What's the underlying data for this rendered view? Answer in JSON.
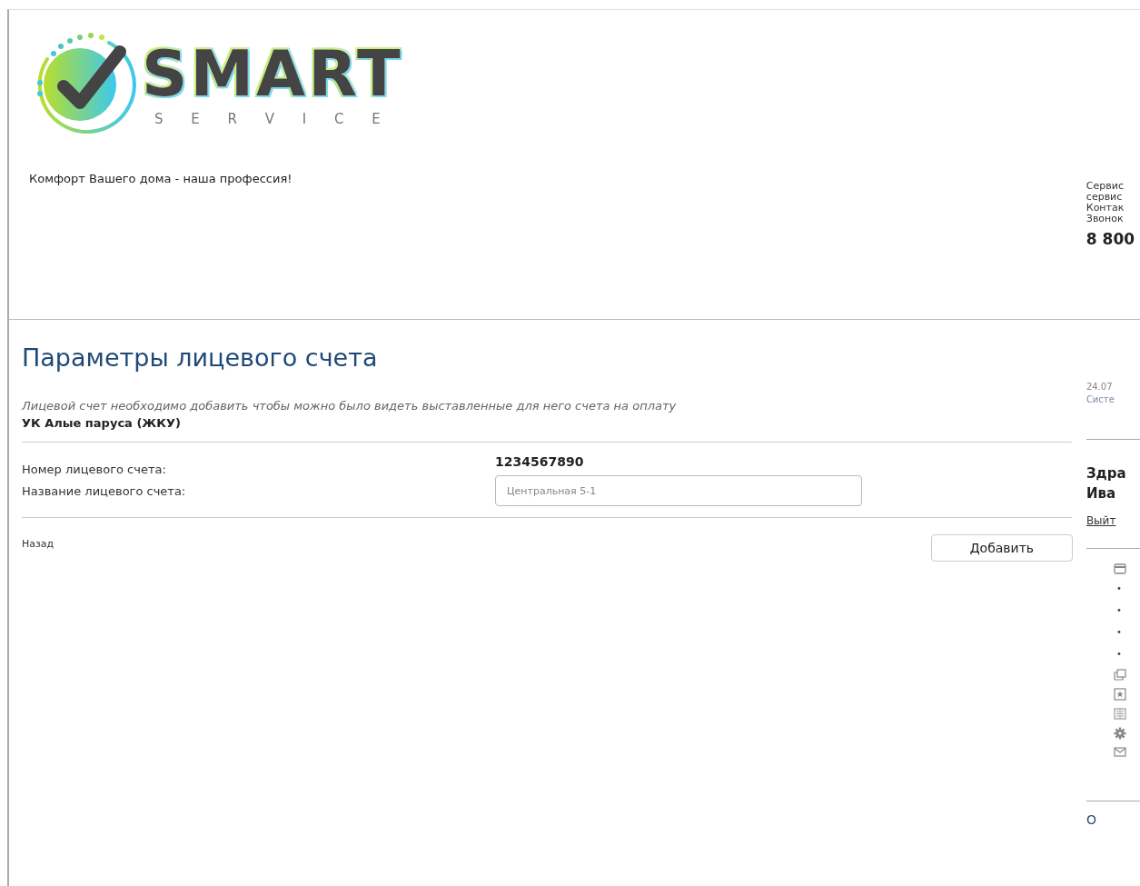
{
  "header": {
    "logo": {
      "word": "SMART",
      "subword": "S E R V I C E"
    },
    "tagline": "Комфорт Вашего дома - наша профессия!",
    "contact_lines": [
      "Сервис",
      "сервис",
      "Контак",
      "Звонок"
    ],
    "phone": "8 800"
  },
  "form": {
    "title": "Параметры лицевого счета",
    "description": "Лицевой счет необходимо добавить чтобы можно было видеть выставленные для него счета на оплату",
    "company": "УК Алые паруса (ЖКУ)",
    "fields": [
      {
        "kind": "static",
        "label": "Номер лицевого счета:",
        "value": "1234567890"
      },
      {
        "kind": "input",
        "label": "Название лицевого счета:",
        "placeholder": "Центральная 5-1"
      }
    ],
    "back_link": "Назад",
    "add_button": "Добавить"
  },
  "sidebar": {
    "date": "24.07",
    "system": "Систе",
    "greeting": "Здра",
    "name": "Ива",
    "logout": "Выйт",
    "menu": [
      {
        "kind": "card"
      },
      {
        "kind": "bullet",
        "text": "•"
      },
      {
        "kind": "bullet",
        "text": "•"
      },
      {
        "kind": "bullet",
        "text": "•"
      },
      {
        "kind": "bullet",
        "text": "•"
      },
      {
        "kind": "copy"
      },
      {
        "kind": "star"
      },
      {
        "kind": "book"
      },
      {
        "kind": "gear"
      },
      {
        "kind": "mail"
      }
    ],
    "footer": "О"
  }
}
